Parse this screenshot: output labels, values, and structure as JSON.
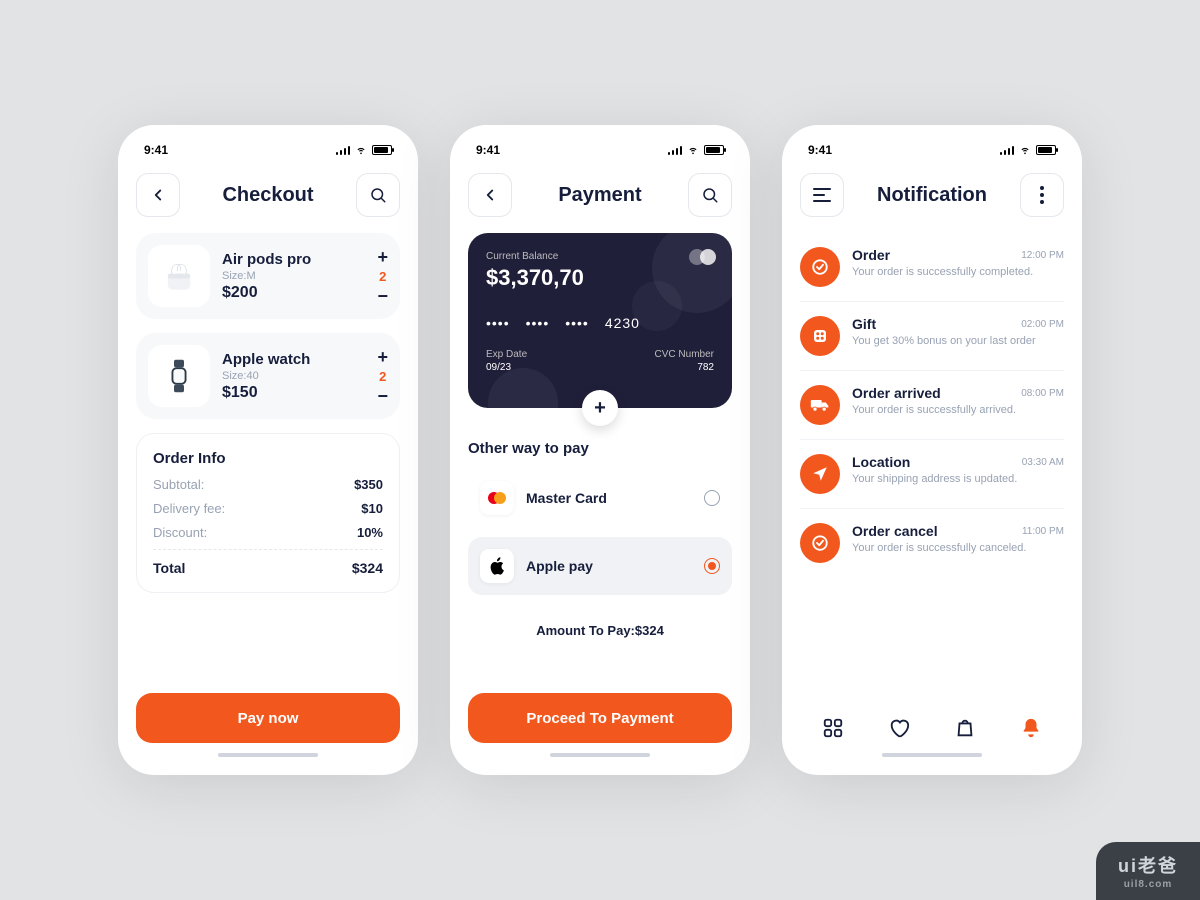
{
  "status_time": "9:41",
  "checkout": {
    "title": "Checkout",
    "items": [
      {
        "name": "Air pods pro",
        "size": "Size:M",
        "price": "$200",
        "qty": "2"
      },
      {
        "name": "Apple watch",
        "size": "Size:40",
        "price": "$150",
        "qty": "2"
      }
    ],
    "order_label": "Order Info",
    "rows": {
      "subtotal_l": "Subtotal:",
      "subtotal_v": "$350",
      "delivery_l": "Delivery fee:",
      "delivery_v": "$10",
      "discount_l": "Discount:",
      "discount_v": "10%",
      "total_l": "Total",
      "total_v": "$324"
    },
    "cta": "Pay now"
  },
  "payment": {
    "title": "Payment",
    "card": {
      "balance_l": "Current Balance",
      "balance_v": "$3,370,70",
      "number_last": "4230",
      "exp_l": "Exp Date",
      "exp_v": "09/23",
      "cvc_l": "CVC Number",
      "cvc_v": "782"
    },
    "other_h": "Other way to pay",
    "options": [
      {
        "name": "Master Card",
        "selected": false
      },
      {
        "name": "Apple pay",
        "selected": true
      }
    ],
    "amount_l": "Amount To Pay:",
    "amount_v": "$324",
    "cta": "Proceed To Payment"
  },
  "notif": {
    "title": "Notification",
    "items": [
      {
        "title": "Order",
        "time": "12:00 PM",
        "desc": "Your order is successfully completed."
      },
      {
        "title": "Gift",
        "time": "02:00 PM",
        "desc": "You get 30% bonus on your last order"
      },
      {
        "title": "Order arrived",
        "time": "08:00 PM",
        "desc": "Your order is successfully arrived."
      },
      {
        "title": "Location",
        "time": "03:30 AM",
        "desc": "Your shipping address is updated."
      },
      {
        "title": "Order cancel",
        "time": "11:00 PM",
        "desc": "Your order is successfully canceled."
      }
    ]
  },
  "watermark": {
    "main": "ui老爸",
    "sub": "uil8.com"
  }
}
